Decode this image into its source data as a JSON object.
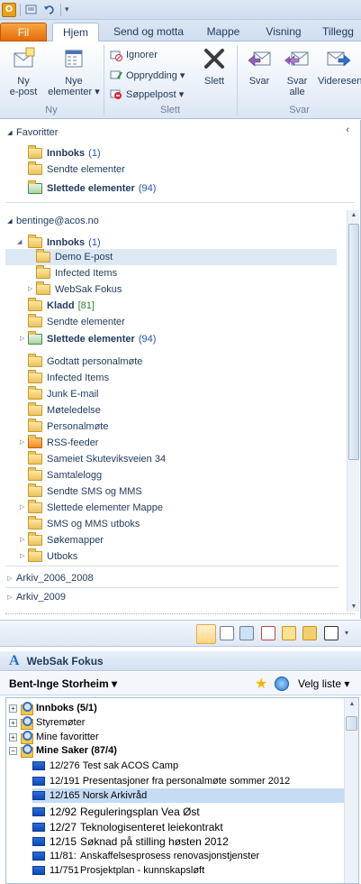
{
  "qat": {
    "app_letter": "O"
  },
  "tabs": [
    "Fil",
    "Hjem",
    "Send og motta",
    "Mappe",
    "Visning",
    "Tillegg"
  ],
  "ribbon": {
    "new_email": [
      "Ny",
      "e-post"
    ],
    "new_items": [
      "Nye",
      "elementer ▾"
    ],
    "ignore": "Ignorer",
    "cleanup": "Opprydding ▾",
    "junk": "Søppelpost ▾",
    "delete": "Slett",
    "reply": "Svar",
    "reply_all": [
      "Svar",
      "alle"
    ],
    "forward": "Videresen",
    "groups": {
      "new": "Ny",
      "delete": "Slett",
      "respond": "Svar"
    }
  },
  "nav": {
    "favorites_title": "Favoritter",
    "favorites": [
      {
        "label": "Innboks",
        "count": "(1)"
      },
      {
        "label": "Sendte elementer",
        "count": ""
      },
      {
        "label": "Slettede elementer",
        "count": "(94)"
      }
    ],
    "account": "bentinge@acos.no",
    "folders": [
      {
        "label": "Innboks",
        "count": "(1)"
      },
      {
        "label": "Demo E-post",
        "count": ""
      },
      {
        "label": "Infected Items",
        "count": ""
      },
      {
        "label": "WebSak Fokus",
        "count": ""
      },
      {
        "label": "Kladd",
        "count": "[81]"
      },
      {
        "label": "Sendte elementer",
        "count": ""
      },
      {
        "label": "Slettede elementer",
        "count": "(94)"
      },
      {
        "label": "Godtatt personalmøte",
        "count": ""
      },
      {
        "label": "Infected Items",
        "count": ""
      },
      {
        "label": "Junk E-mail",
        "count": ""
      },
      {
        "label": "Møteledelse",
        "count": ""
      },
      {
        "label": "Personalmøte",
        "count": ""
      },
      {
        "label": "RSS-feeder",
        "count": ""
      },
      {
        "label": "Sameiet Skuteviksveien 34",
        "count": ""
      },
      {
        "label": "Samtalelogg",
        "count": ""
      },
      {
        "label": "Sendte SMS og MMS",
        "count": ""
      },
      {
        "label": "Slettede elementer Mappe",
        "count": ""
      },
      {
        "label": "SMS og MMS utboks",
        "count": ""
      },
      {
        "label": "Søkemapper",
        "count": ""
      },
      {
        "label": "Utboks",
        "count": ""
      }
    ],
    "archives": [
      "Arkiv_2006_2008",
      "Arkiv_2009"
    ]
  },
  "websak": {
    "title": "WebSak Fokus",
    "user": "Bent-Inge Storheim ▾",
    "choose_list": "Velg liste ▾",
    "tree": [
      {
        "label": "Innboks (5/1)"
      },
      {
        "label": "Styremøter"
      },
      {
        "label": "Mine favoritter"
      },
      {
        "label": "Mine Saker (87/4)"
      }
    ],
    "cases": [
      {
        "id": "12/276",
        "title": "Test sak ACOS Camp"
      },
      {
        "id": "12/191",
        "title": "Presentasjoner fra personalmøte sommer 2012"
      },
      {
        "id": "12/165",
        "title": "Norsk Arkivråd"
      },
      {
        "id": "12/92",
        "title": "Reguleringsplan Vea Øst"
      },
      {
        "id": "12/27",
        "title": "Teknologisenteret leiekontrakt"
      },
      {
        "id": "12/15",
        "title": "Søknad på stilling høsten 2012"
      },
      {
        "id": "11/81:",
        "title": "Anskaffelsesprosess renovasjonstjenster"
      },
      {
        "id": "11/751",
        "title": "Prosjektplan - kunnskapsløft"
      }
    ]
  }
}
